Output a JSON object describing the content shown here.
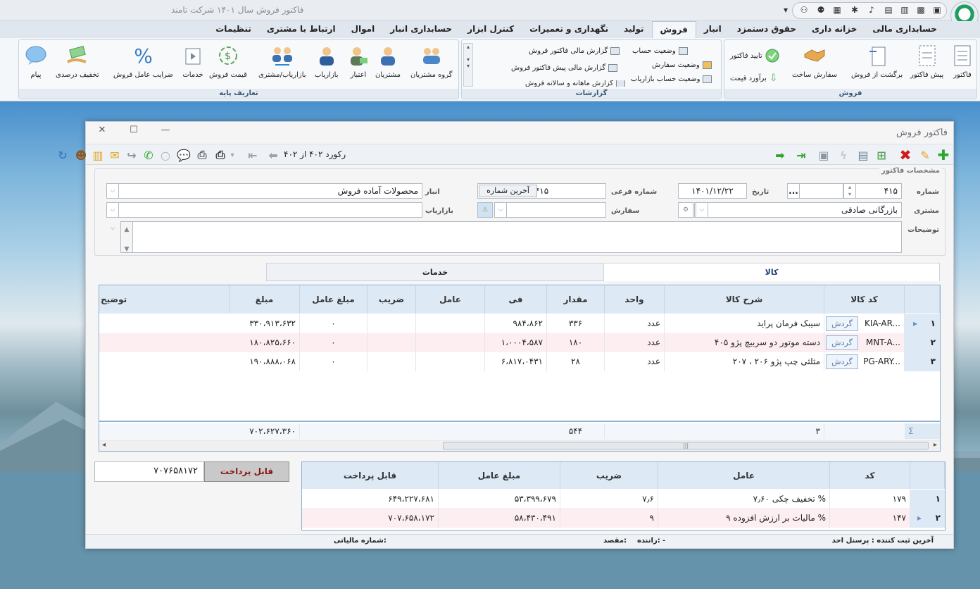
{
  "app": {
    "title": "فاکتور فروش    سال ۱۴۰۱ شرکت تامند",
    "menu_tabs": [
      "حسابداری مالی",
      "خزانه داری",
      "حقوق دستمزد",
      "انبار",
      "فروش",
      "تولید",
      "نگهداری و تعمیرات",
      "کنترل ابزار",
      "حسابداری انبار",
      "اموال",
      "ارتباط با مشتری",
      "تنظیمات"
    ],
    "active_tab": "فروش"
  },
  "ribbon": {
    "sales_group": {
      "caption": "فروش",
      "buttons": [
        "فاکتور",
        "پیش فاکتور",
        "برگشت از فروش",
        "سفارش ساخت"
      ],
      "small_buttons": [
        "تایید فاکتور",
        "برآورد قیمت"
      ]
    },
    "reports_group": {
      "caption": "گزارشات",
      "items": [
        "وضعیت حساب",
        "وضعیت سفارش",
        "وضعیت حساب بازاریاب",
        "گزارش مالی فاکتور فروش",
        "گزارش مالی پیش فاکتور فروش",
        "گزارش ماهانه و سالانه فروش"
      ]
    },
    "base_group": {
      "caption": "تعاریف پایه",
      "buttons": [
        "گروه مشتریان",
        "مشتریان",
        "اعتبار",
        "بازاریاب",
        "بازاریاب/مشتری",
        "قیمت فروش",
        "خدمات",
        "ضرایب عامل فروش",
        "تخفیف درصدی",
        "پیام"
      ]
    }
  },
  "window": {
    "title": "فاکتور فروش",
    "record_label": "رکورد ۴۰۲ از ۴۰۲"
  },
  "form": {
    "legend": "مشخصات فاکتور",
    "number_label": "شماره",
    "number_value": "۴۱۵",
    "date_label": "تاریخ",
    "date_value": "۱۴۰۱/۱۲/۲۲",
    "sub_number_label": "شماره فرعی",
    "sub_number_value": "۴۱۵",
    "last_number_button": "آخرین شماره",
    "warehouse_label": "انبار",
    "warehouse_value": "محصولات آماده فروش",
    "customer_label": "مشتری",
    "customer_value": "بازرگانی صادقی",
    "order_label": "سفارش",
    "order_value": "",
    "marketer_label": "بازاریاب",
    "marketer_value": "",
    "desc_label": "توضیحات",
    "desc_value": "",
    "ellipsis": "..."
  },
  "inner_tabs": {
    "goods": "کالا",
    "services": "خدمات"
  },
  "items_grid": {
    "columns": [
      "کد کالا",
      "شرح کالا",
      "واحد",
      "مقدار",
      "فی",
      "عامل",
      "ضریب",
      "مبلغ عامل",
      "مبلغ",
      "توضیح"
    ],
    "turnover_label": "گردش",
    "rows": [
      {
        "idx": "۱",
        "code": "KIA-AR...",
        "desc": "سیبک فرمان پراید",
        "unit": "عدد",
        "qty": "۳۳۶",
        "price": "۹۸۴،۸۶۲",
        "factor_amount": "۰",
        "amount": "۳۳۰،۹۱۳،۶۳۲"
      },
      {
        "idx": "۲",
        "code": "MNT-A...",
        "desc": "دسته موتور دو سربیچ پژو ۴۰۵",
        "unit": "عدد",
        "qty": "۱۸۰",
        "price": "۱،۰۰۰۴،۵۸۷",
        "factor_amount": "۰",
        "amount": "۱۸۰،۸۲۵،۶۶۰"
      },
      {
        "idx": "۳",
        "code": "PG-ARY...",
        "desc": "مثلثی چپ پژو ۲۰۶ ، ۲۰۷",
        "unit": "عدد",
        "qty": "۲۸",
        "price": "۶،۸۱۷،۰۴۳۱",
        "factor_amount": "۰",
        "amount": "۱۹۰،۸۸۸،۰۶۸"
      }
    ],
    "footer": {
      "sigma": "Σ",
      "count": "۳",
      "qty_total": "۵۴۴",
      "amount_total": "۷۰۲،۶۲۷،۳۶۰"
    }
  },
  "payable": {
    "label": "قابل پرداخت",
    "value": "۷۰۷۶۵۸۱۷۲"
  },
  "factors_grid": {
    "columns": [
      "کد",
      "عامل",
      "ضریب",
      "مبلغ عامل",
      "قابل پرداخت"
    ],
    "rows": [
      {
        "idx": "۱",
        "code": "۱۷۹",
        "factor": "تخفیف چکی ۷٫۶۰ %",
        "coef": "۷٫۶",
        "factor_amount": "۵۳،۳۹۹،۶۷۹",
        "payable": "۶۴۹،۲۲۷،۶۸۱"
      },
      {
        "idx": "۲",
        "code": "۱۴۷",
        "factor": "مالیات بر ارزش افزوده ۹ %",
        "coef": "۹",
        "factor_amount": "۵۸،۴۳۰،۴۹۱",
        "payable": "۷۰۷،۶۵۸،۱۷۲"
      }
    ]
  },
  "status": {
    "last_user": "آخرین ثبت کننده : پرسنل احد",
    "driver": "راننده:  -",
    "destination": "مقصد:",
    "tax_number": "شماره مالیاتی:"
  },
  "colors": {
    "accent": "#3c6fb0",
    "row_alt": "#fdeef2",
    "payable_btn": "#c9c9c9",
    "toolbar_green": "#2fa52f",
    "toolbar_red": "#d0191b"
  }
}
